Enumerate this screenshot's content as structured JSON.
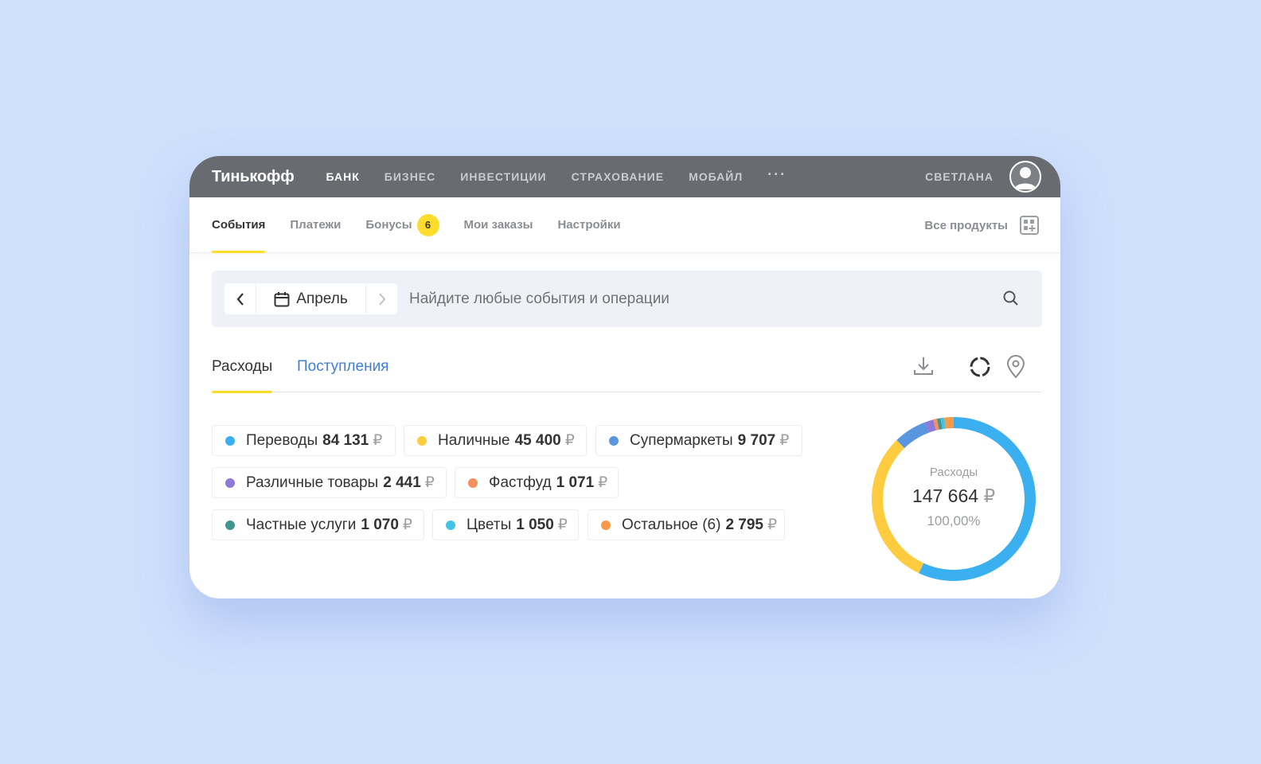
{
  "header": {
    "logo": "Тинькофф",
    "nav": [
      "БАНК",
      "БИЗНЕС",
      "ИНВЕСТИЦИИ",
      "СТРАХОВАНИЕ",
      "МОБАЙЛ"
    ],
    "more": "···",
    "username": "СВЕТЛАНА"
  },
  "subnav": {
    "tabs": [
      "События",
      "Платежи",
      "Бонусы",
      "Мои заказы",
      "Настройки"
    ],
    "bonus_count": "6",
    "all_products": "Все продукты"
  },
  "search": {
    "month": "Апрель",
    "placeholder": "Найдите любые события и операции"
  },
  "tabs": {
    "expenses": "Расходы",
    "income": "Поступления"
  },
  "categories": [
    {
      "name": "Переводы",
      "amount": "84 131",
      "currency": "₽",
      "color": "#3bb0f0"
    },
    {
      "name": "Наличные",
      "amount": "45 400",
      "currency": "₽",
      "color": "#ffcc40"
    },
    {
      "name": "Супермаркеты",
      "amount": "9 707",
      "currency": "₽",
      "color": "#5a96e0"
    },
    {
      "name": "Различные товары",
      "amount": "2 441",
      "currency": "₽",
      "color": "#8f78d8"
    },
    {
      "name": "Фастфуд",
      "amount": "1 071",
      "currency": "₽",
      "color": "#f5905a"
    },
    {
      "name": "Частные услуги",
      "amount": "1 070",
      "currency": "₽",
      "color": "#3f9590"
    },
    {
      "name": "Цветы",
      "amount": "1 050",
      "currency": "₽",
      "color": "#44c2e6"
    },
    {
      "name": "Остальное (6)",
      "amount": "2 795",
      "currency": "₽",
      "color": "#f79a48"
    }
  ],
  "summary": {
    "label": "Расходы",
    "total": "147 664",
    "currency": "₽",
    "percent": "100,00%"
  },
  "chart_data": {
    "type": "pie",
    "categories": [
      "Переводы",
      "Наличные",
      "Супермаркеты",
      "Различные товары",
      "Фастфуд",
      "Частные услуги",
      "Цветы",
      "Остальное (6)"
    ],
    "values": [
      84131,
      45400,
      9707,
      2441,
      1071,
      1070,
      1050,
      2795
    ]
  }
}
